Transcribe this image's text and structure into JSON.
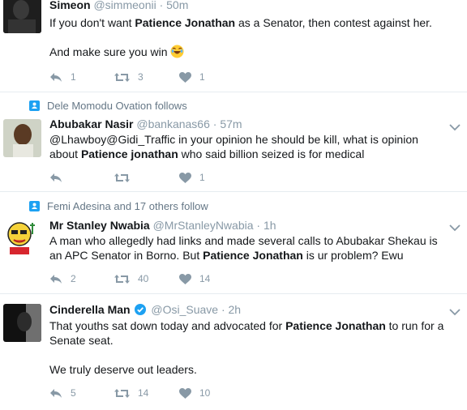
{
  "tweets": [
    {
      "name": "Simeon",
      "handle": "@simmeonii",
      "time": "· 50m",
      "body_1_pre": "If you don't want ",
      "body_1_bold": "Patience Jonathan",
      "body_1_post": " as a Senator, then contest against her.",
      "body_2": "And make sure you win",
      "reply_count": "1",
      "retweet_count": "3",
      "like_count": "1"
    },
    {
      "social": "Dele Momodu Ovation follows",
      "name": "Abubakar Nasir",
      "handle": "@bankanas66",
      "time": "· 57m",
      "body_1": "@Lhawboy@Gidi_Traffic  in your opinion he should be kill, what is opinion",
      "body_2_pre": "about  ",
      "body_2_bold": "Patience jonathan",
      "body_2_post": " who said billion seized is for medical",
      "like_count": "1"
    },
    {
      "social": "Femi Adesina and 17 others follow",
      "name": "Mr Stanley Nwabia",
      "handle": "@MrStanleyNwabia",
      "time": "· 1h",
      "body_1": "A man who allegedly had links and made several calls to Abubakar Shekau is",
      "body_2_pre": "an APC Senator in Borno. But ",
      "body_2_bold": "Patience Jonathan",
      "body_2_post": " is ur problem? Ewu",
      "reply_count": "2",
      "retweet_count": "40",
      "like_count": "14"
    },
    {
      "name": "Cinderella Man",
      "handle": "@Osi_Suave",
      "time": "· 2h",
      "body_1_pre": "That youths sat down today and advocated for ",
      "body_1_bold": "Patience Jonathan",
      "body_1_post": " to run for a",
      "body_2": "Senate seat.",
      "body_3": "We truly deserve out leaders.",
      "reply_count": "5",
      "retweet_count": "14",
      "like_count": "10"
    }
  ]
}
